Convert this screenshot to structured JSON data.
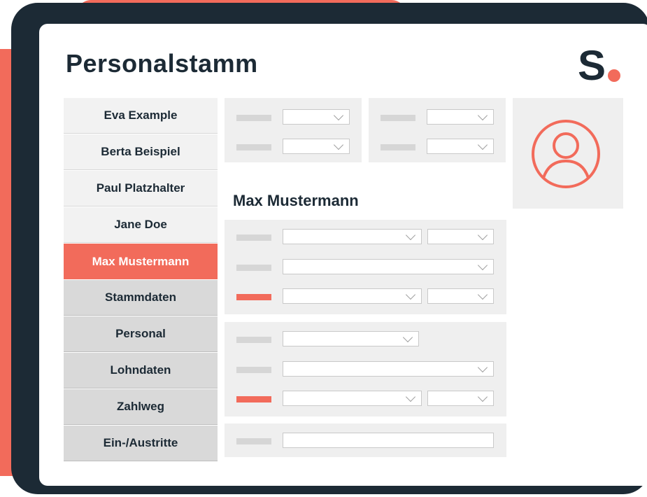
{
  "page": {
    "title": "Personalstamm",
    "logo": "S",
    "accent_color": "#f26b5b",
    "dark_color": "#1c2a35"
  },
  "sidebar": {
    "people": [
      {
        "label": "Eva Example"
      },
      {
        "label": "Berta Beispiel"
      },
      {
        "label": "Paul Platzhalter"
      },
      {
        "label": "Jane Doe"
      }
    ],
    "active": {
      "label": "Max Mustermann"
    },
    "sections": [
      {
        "label": "Stammdaten"
      },
      {
        "label": "Personal"
      },
      {
        "label": "Lohndaten"
      },
      {
        "label": "Zahlweg"
      },
      {
        "label": "Ein-/Austritte"
      }
    ]
  },
  "main": {
    "heading": "Max Mustermann",
    "avatar_icon": "user-circle-icon"
  }
}
